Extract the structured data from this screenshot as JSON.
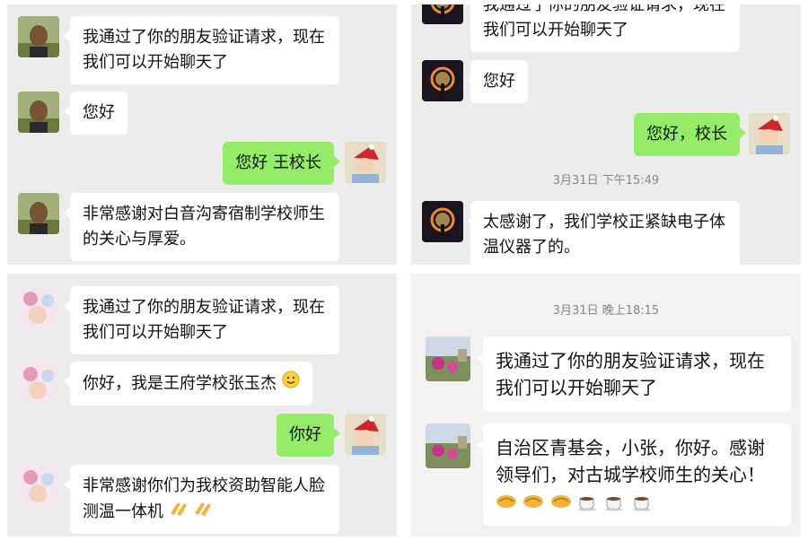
{
  "panel1": {
    "messages": [
      {
        "text": "我通过了你的朋友验证请求，现在我们可以开始聊天了"
      },
      {
        "text": "您好"
      },
      {
        "text": "您好 王校长"
      },
      {
        "text": "非常感谢对白音沟寄宿制学校师生的关心与厚爱。"
      }
    ]
  },
  "panel2": {
    "messages": [
      {
        "text": "我通过了你的朋友验证请求，现在我们可以开始聊天了"
      },
      {
        "text": "您好"
      },
      {
        "text": "您好，校长"
      },
      {
        "text": "太感谢了，我们学校正紧缺电子体温仪器了的。"
      }
    ],
    "timestamp": "3月31日 下午15:49"
  },
  "panel3": {
    "messages": [
      {
        "text": "我通过了你的朋友验证请求，现在我们可以开始聊天了"
      },
      {
        "text": "你好，我是王府学校张玉杰"
      },
      {
        "text": "你好"
      },
      {
        "text": "非常感谢你们为我校资助智能人脸测温一体机"
      }
    ]
  },
  "panel4": {
    "timestamp": "3月31日 晚上18:15",
    "messages": [
      {
        "text": "我通过了你的朋友验证请求，现在我们可以开始聊天了"
      },
      {
        "text": "自治区青基会，小张，你好。感谢领导们，对古城学校师生的关心！"
      }
    ]
  },
  "colors": {
    "incoming": "#ffffff",
    "outgoing": "#95ec69",
    "background": "#ececec"
  },
  "icons": [
    "man-avatar-icon",
    "sun-glow-avatar-icon",
    "child-santa-avatar-icon",
    "girl-collage-avatar-icon",
    "garden-avatar-icon",
    "smile-emoji-icon",
    "clap-emoji-icon",
    "handshake-emoji-icon",
    "coffee-emoji-icon"
  ]
}
